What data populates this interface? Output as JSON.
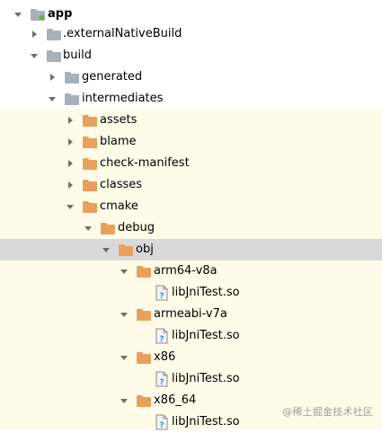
{
  "colors": {
    "cream_background": "#fefce8",
    "selected_background": "#d9d9d9",
    "gray_folder": "#a9b0b8",
    "orange_folder": "#e8a05c",
    "arrow": "#6e6e6e",
    "module_dot": "#62b543"
  },
  "tree": {
    "nodes": [
      {
        "label": "app",
        "bold": true,
        "icon": "module-folder-icon",
        "expanded": true
      },
      {
        "label": ".externalNativeBuild",
        "icon": "folder-gray-icon",
        "expanded": false
      },
      {
        "label": "build",
        "icon": "folder-gray-icon",
        "expanded": true
      },
      {
        "label": "generated",
        "icon": "folder-gray-icon",
        "expanded": false
      },
      {
        "label": "intermediates",
        "icon": "folder-gray-icon",
        "expanded": true
      },
      {
        "label": "assets",
        "icon": "folder-orange-icon",
        "expanded": false
      },
      {
        "label": "blame",
        "icon": "folder-orange-icon",
        "expanded": false
      },
      {
        "label": "check-manifest",
        "icon": "folder-orange-icon",
        "expanded": false
      },
      {
        "label": "classes",
        "icon": "folder-orange-icon",
        "expanded": false
      },
      {
        "label": "cmake",
        "icon": "folder-orange-icon",
        "expanded": true
      },
      {
        "label": "debug",
        "icon": "folder-orange-icon",
        "expanded": true
      },
      {
        "label": "obj",
        "icon": "folder-orange-icon",
        "expanded": true,
        "selected": true
      },
      {
        "label": "arm64-v8a",
        "icon": "folder-orange-icon",
        "expanded": true
      },
      {
        "label": "libJniTest.so",
        "icon": "unknown-file-icon"
      },
      {
        "label": "armeabi-v7a",
        "icon": "folder-orange-icon",
        "expanded": true
      },
      {
        "label": "libJniTest.so",
        "icon": "unknown-file-icon"
      },
      {
        "label": "x86",
        "icon": "folder-orange-icon",
        "expanded": true
      },
      {
        "label": "libJniTest.so",
        "icon": "unknown-file-icon"
      },
      {
        "label": "x86_64",
        "icon": "folder-orange-icon",
        "expanded": true
      },
      {
        "label": "libJniTest.so",
        "icon": "unknown-file-icon"
      }
    ]
  },
  "watermark": {
    "text": "@稀土掘金技术社区"
  }
}
